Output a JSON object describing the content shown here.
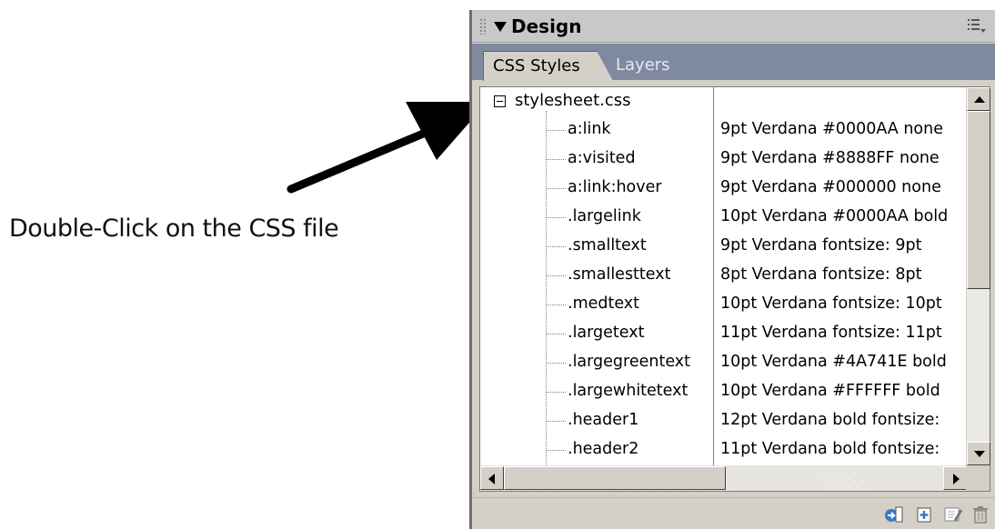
{
  "annotation": {
    "text": "Double-Click on the CSS file"
  },
  "panel": {
    "title": "Design",
    "icons": {
      "collapse": "triangle-down-icon",
      "options": "list-menu-icon",
      "grip": "grip-icon"
    },
    "tabs": [
      {
        "label": "CSS Styles",
        "active": true
      },
      {
        "label": "Layers",
        "active": false
      }
    ]
  },
  "tree": {
    "root": "stylesheet.css",
    "rules": [
      {
        "selector": "a:link",
        "properties": "9pt Verdana #0000AA none"
      },
      {
        "selector": "a:visited",
        "properties": "9pt Verdana #8888FF none"
      },
      {
        "selector": "a:link:hover",
        "properties": "9pt Verdana #000000 none"
      },
      {
        "selector": ".largelink",
        "properties": "10pt Verdana #0000AA bold"
      },
      {
        "selector": ".smalltext",
        "properties": "9pt Verdana fontsize: 9pt"
      },
      {
        "selector": ".smallesttext",
        "properties": "8pt Verdana fontsize: 8pt"
      },
      {
        "selector": ".medtext",
        "properties": "10pt Verdana fontsize: 10pt"
      },
      {
        "selector": ".largetext",
        "properties": "11pt Verdana fontsize: 11pt"
      },
      {
        "selector": ".largegreentext",
        "properties": "10pt Verdana #4A741E bold"
      },
      {
        "selector": ".largewhitetext",
        "properties": "10pt Verdana #FFFFFF bold"
      },
      {
        "selector": ".header1",
        "properties": "12pt Verdana bold fontsize:"
      },
      {
        "selector": ".header2",
        "properties": "11pt Verdana bold fontsize:"
      }
    ]
  },
  "toolbar_icons": [
    "attach-stylesheet-icon",
    "new-css-rule-icon",
    "edit-style-icon",
    "delete-icon"
  ],
  "colors": {
    "panel_bg": "#d4d0c8",
    "tab_strip": "#7f8aa1",
    "title_bar": "#c8c8c8"
  }
}
